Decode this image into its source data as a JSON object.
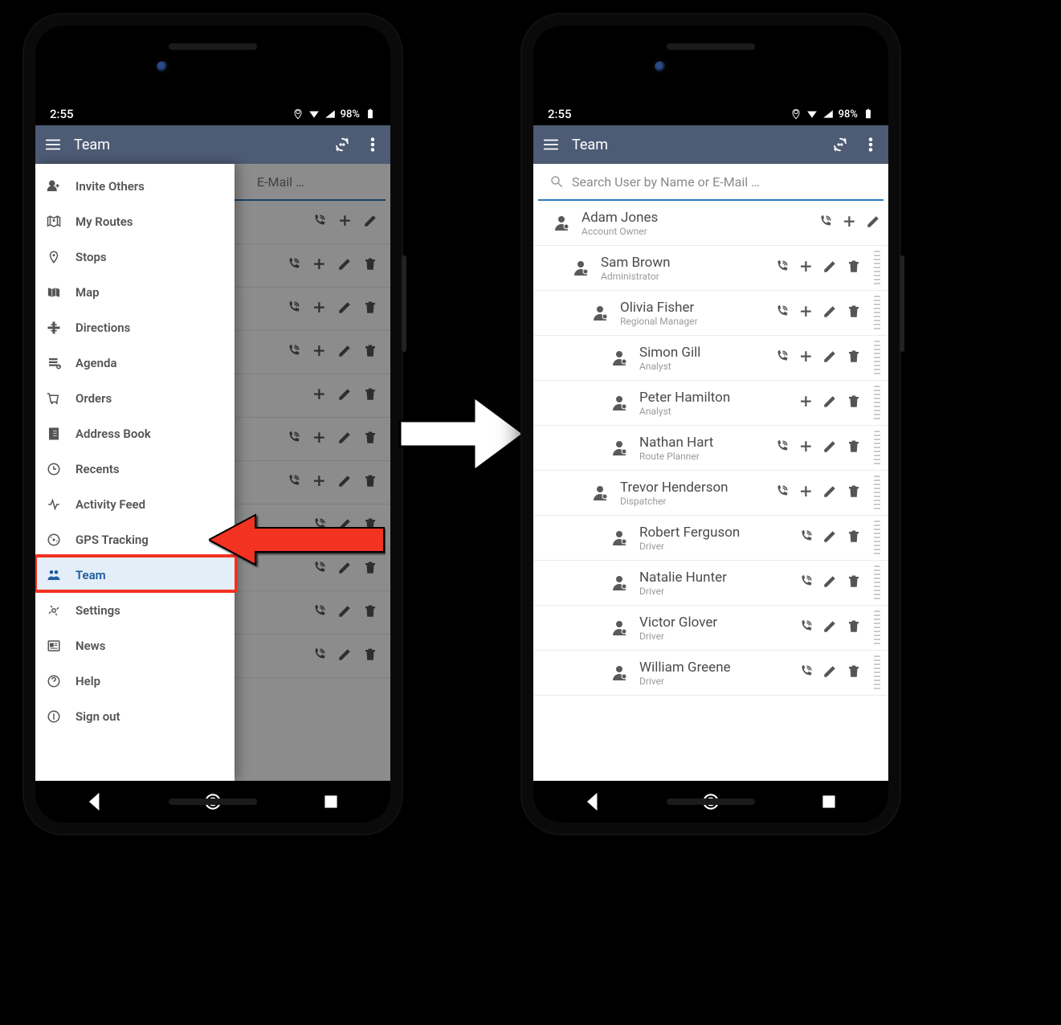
{
  "status": {
    "time": "2:55",
    "battery": "98%"
  },
  "appbar": {
    "title": "Team"
  },
  "search": {
    "placeholder": "Search User by Name or E-Mail …"
  },
  "search_peek": "E-Mail …",
  "drawer": {
    "items": [
      {
        "label": "Invite Others"
      },
      {
        "label": "My Routes"
      },
      {
        "label": "Stops"
      },
      {
        "label": "Map"
      },
      {
        "label": "Directions"
      },
      {
        "label": "Agenda"
      },
      {
        "label": "Orders"
      },
      {
        "label": "Address Book"
      },
      {
        "label": "Recents"
      },
      {
        "label": "Activity Feed"
      },
      {
        "label": "GPS Tracking"
      },
      {
        "label": "Team"
      },
      {
        "label": "Settings"
      },
      {
        "label": "News"
      },
      {
        "label": "Help"
      },
      {
        "label": "Sign out"
      }
    ],
    "active_index": 11
  },
  "bg_rows": [
    {
      "actions": [
        "call",
        "add",
        "edit"
      ]
    },
    {
      "actions": [
        "call",
        "add",
        "edit",
        "delete"
      ]
    },
    {
      "actions": [
        "call",
        "add",
        "edit",
        "delete"
      ]
    },
    {
      "actions": [
        "call",
        "add",
        "edit",
        "delete"
      ]
    },
    {
      "actions": [
        "add",
        "edit",
        "delete"
      ]
    },
    {
      "actions": [
        "call",
        "add",
        "edit",
        "delete"
      ]
    },
    {
      "actions": [
        "call",
        "add",
        "edit",
        "delete"
      ]
    },
    {
      "actions": [
        "call",
        "edit",
        "delete"
      ]
    },
    {
      "actions": [
        "call",
        "edit",
        "delete"
      ]
    },
    {
      "actions": [
        "call",
        "edit",
        "delete"
      ]
    },
    {
      "actions": [
        "call",
        "edit",
        "delete"
      ]
    }
  ],
  "team": [
    {
      "name": "Adam Jones",
      "role": "Account Owner",
      "indent": 0,
      "actions": [
        "call",
        "add",
        "edit"
      ],
      "grip": false
    },
    {
      "name": "Sam Brown",
      "role": "Administrator",
      "indent": 1,
      "actions": [
        "call",
        "add",
        "edit",
        "delete"
      ],
      "grip": true
    },
    {
      "name": "Olivia Fisher",
      "role": "Regional Manager",
      "indent": 2,
      "actions": [
        "call",
        "add",
        "edit",
        "delete"
      ],
      "grip": true
    },
    {
      "name": "Simon Gill",
      "role": "Analyst",
      "indent": 3,
      "actions": [
        "call",
        "add",
        "edit",
        "delete"
      ],
      "grip": true
    },
    {
      "name": "Peter Hamilton",
      "role": "Analyst",
      "indent": 3,
      "actions": [
        "add",
        "edit",
        "delete"
      ],
      "grip": true
    },
    {
      "name": "Nathan Hart",
      "role": "Route Planner",
      "indent": 3,
      "actions": [
        "call",
        "add",
        "edit",
        "delete"
      ],
      "grip": true
    },
    {
      "name": "Trevor Henderson",
      "role": "Dispatcher",
      "indent": 2,
      "actions": [
        "call",
        "add",
        "edit",
        "delete"
      ],
      "grip": true
    },
    {
      "name": "Robert Ferguson",
      "role": "Driver",
      "indent": 3,
      "actions": [
        "call",
        "edit",
        "delete"
      ],
      "grip": true
    },
    {
      "name": "Natalie Hunter",
      "role": "Driver",
      "indent": 3,
      "actions": [
        "call",
        "edit",
        "delete"
      ],
      "grip": true
    },
    {
      "name": "Victor Glover",
      "role": "Driver",
      "indent": 3,
      "actions": [
        "call",
        "edit",
        "delete"
      ],
      "grip": true
    },
    {
      "name": "William Greene",
      "role": "Driver",
      "indent": 3,
      "actions": [
        "call",
        "edit",
        "delete"
      ],
      "grip": true
    }
  ]
}
